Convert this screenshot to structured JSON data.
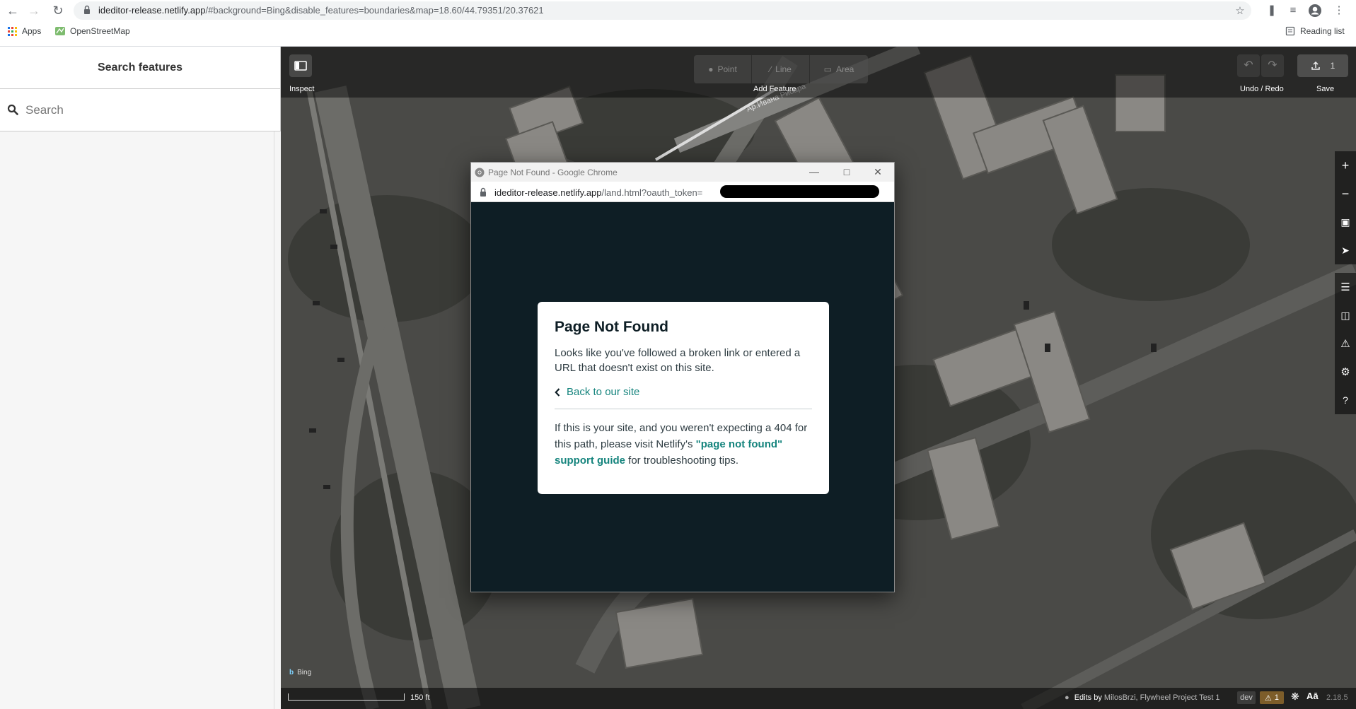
{
  "browser": {
    "url_host": "ideditor-release.netlify.app",
    "url_rest": "/#background=Bing&disable_features=boundaries&map=18.60/44.79351/20.37621",
    "bookmarks": [
      {
        "label": "Apps"
      },
      {
        "label": "OpenStreetMap"
      }
    ],
    "reading_list": "Reading list"
  },
  "sidebar": {
    "title": "Search features",
    "search_placeholder": "Search"
  },
  "map_toolbar": {
    "inspect_label": "Inspect",
    "add_feature_label": "Add Feature",
    "point_label": "Point",
    "line_label": "Line",
    "area_label": "Area",
    "undo_redo_label": "Undo / Redo",
    "save_label": "Save",
    "save_count": "1"
  },
  "map_footer": {
    "scale": "150 ft",
    "edits_prefix": "Edits by",
    "edits_by": "MilosBrzi, Flywheel Project Test 1",
    "branch": "dev",
    "issues_count": "1",
    "version": "2.18.5",
    "background_name": "Bing"
  },
  "popup": {
    "window_title": "Page Not Found - Google Chrome",
    "url_host": "ideditor-release.netlify.app",
    "url_rest": "/land.html?oauth_token=",
    "card": {
      "heading": "Page Not Found",
      "message": "Looks like you've followed a broken link or entered a URL that doesn't exist on this site.",
      "back_link": "Back to our site",
      "support_text_1": "If this is your site, and you weren't expecting a 404 for this path, please visit Netlify's ",
      "support_link": "\"page not found\" support guide",
      "support_text_2": " for troubleshooting tips."
    }
  },
  "colors": {
    "popup_bg": "#0e1e25",
    "netlify_teal": "#15847d"
  }
}
